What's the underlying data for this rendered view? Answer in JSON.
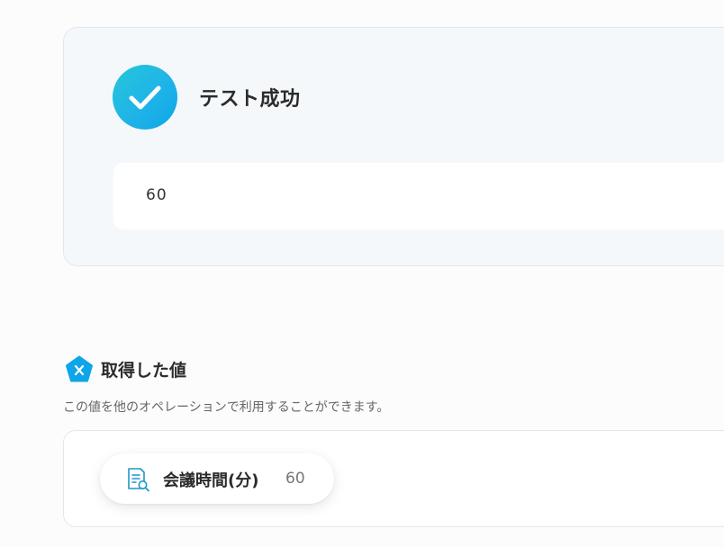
{
  "result": {
    "status_title": "テスト成功",
    "value": "60"
  },
  "retrieved": {
    "icon": "x-pentagon-icon",
    "title": "取得した値",
    "description": "この値を他のオペレーションで利用することができます。",
    "items": [
      {
        "icon": "document-search-icon",
        "label": "会議時間(分)",
        "value": "60"
      }
    ]
  },
  "colors": {
    "accent": "#0ea5e9",
    "success_gradient_start": "#26c6da",
    "card_background": "#f5f8fb"
  }
}
